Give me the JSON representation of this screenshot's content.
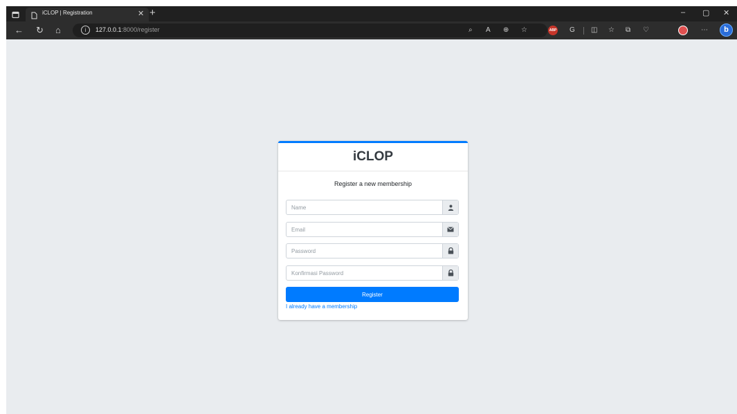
{
  "browser": {
    "tab_title": "iCLOP | Registration",
    "url_host": "127.0.0.1",
    "url_path": ":8000/register",
    "abp_label": "ABP",
    "bing_label": "b"
  },
  "form": {
    "brand": "iCLOP",
    "message": "Register a new membership",
    "name_placeholder": "Name",
    "email_placeholder": "Email",
    "password_placeholder": "Password",
    "confirm_placeholder": "Konfirmasi Password",
    "register_label": "Register",
    "login_link": "I already have a membership"
  },
  "colors": {
    "accent": "#007bff",
    "page_bg": "#e9ecef",
    "browser_dark": "#202020"
  }
}
